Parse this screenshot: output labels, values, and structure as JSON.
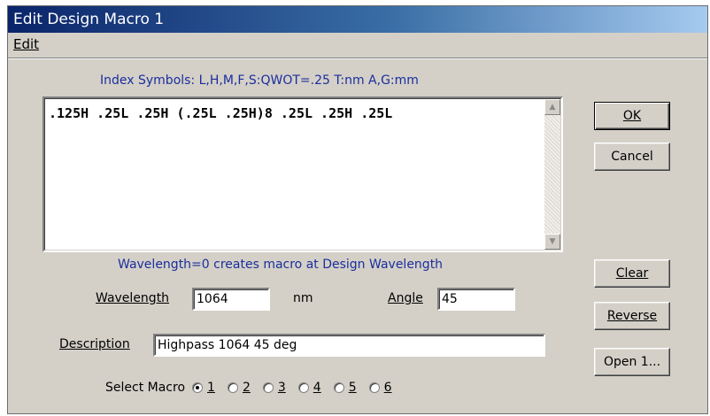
{
  "window": {
    "title": "Edit Design Macro 1"
  },
  "menu": {
    "edit": "Edit"
  },
  "index_symbols": "Index Symbols: L,H,M,F,S:QWOT=.25  T:nm  A,G:mm",
  "macro_text": ".125H .25L .25H (.25L .25H)8 .25L .25H .25L",
  "wavelength_hint": "Wavelength=0 creates macro at Design Wavelength",
  "buttons": {
    "ok": "OK",
    "cancel": "Cancel",
    "clear": "Clear",
    "reverse": "Reverse",
    "open": "Open 1..."
  },
  "fields": {
    "wavelength_label": "Wavelength",
    "wavelength_value": "1064",
    "wavelength_unit": "nm",
    "angle_label": "Angle",
    "angle_value": "45",
    "description_label": "Description",
    "description_value": "Highpass 1064 45 deg"
  },
  "select_macro": {
    "label": "Select Macro",
    "options": [
      "1",
      "2",
      "3",
      "4",
      "5",
      "6"
    ],
    "selected": "1"
  },
  "scroll_icons": {
    "up": "scroll-up-icon",
    "down": "scroll-down-icon"
  }
}
